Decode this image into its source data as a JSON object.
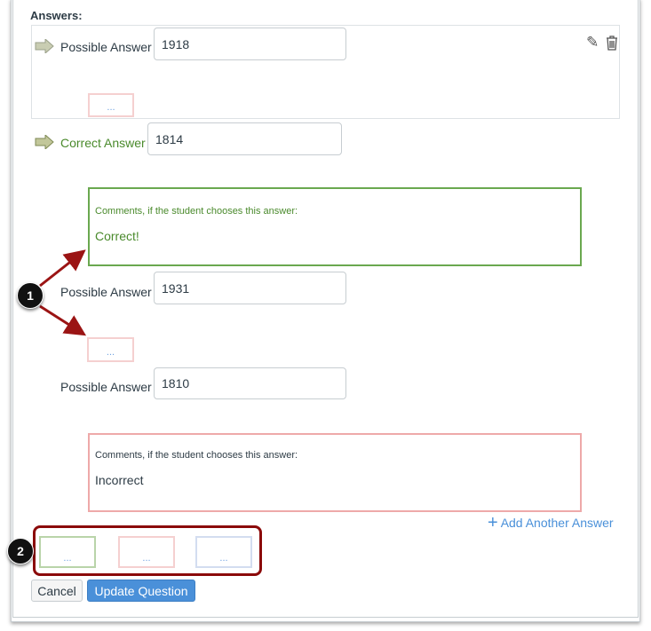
{
  "answers_label": "Answers:",
  "answers": [
    {
      "label": "Possible Answer",
      "value": "1918",
      "comment_placeholder": "..."
    },
    {
      "label": "Correct Answer",
      "value": "1814",
      "comment_heading": "Comments, if the student chooses this answer:",
      "comment": "Correct!"
    },
    {
      "label": "Possible Answer",
      "value": "1931",
      "comment_placeholder": "..."
    },
    {
      "label": "Possible Answer",
      "value": "1810",
      "comment_heading": "Comments, if the student chooses this answer:",
      "comment": "Incorrect"
    }
  ],
  "add_answer": "Add Another Answer",
  "comment_buttons": [
    "...",
    "...",
    "..."
  ],
  "cancel": "Cancel",
  "update": "Update Question",
  "callouts": [
    "1",
    "2"
  ],
  "colors": {
    "correct": "#4a8a2c",
    "incorrect": "#e8a4a4",
    "accent": "#4a90d9",
    "callout": "#8b0a0a"
  }
}
